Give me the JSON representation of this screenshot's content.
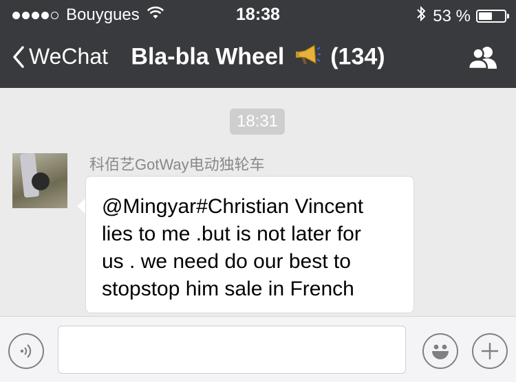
{
  "status_bar": {
    "carrier": "Bouygues",
    "time": "18:38",
    "battery_percent": "53 %",
    "battery_level": 0.53,
    "signal_filled_dots": 4,
    "signal_total_dots": 5
  },
  "nav": {
    "back_label": "WeChat",
    "title_main": "Bla-bla Wheel",
    "title_count": "(134)"
  },
  "chat": {
    "timestamp": "18:31",
    "messages": [
      {
        "sender": "科佰艺GotWay电动独轮车",
        "text": "@Mingyar#Christian  Vincent\nlies to me .but is not later for\nus . we need  do our best to\nstopstop him sale in  French"
      }
    ]
  },
  "input": {
    "value": "",
    "placeholder": ""
  },
  "colors": {
    "header_bg": "#393a3e",
    "chat_bg": "#ebebeb",
    "bubble_bg": "#ffffff",
    "input_bar_bg": "#f4f4f6"
  },
  "icons": {
    "back": "chevron-left-icon",
    "megaphone": "megaphone-icon",
    "contacts": "group-contacts-icon",
    "voice": "voice-icon",
    "emoji": "emoji-icon",
    "plus": "plus-icon",
    "wifi": "wifi-icon",
    "bluetooth": "bluetooth-icon",
    "battery": "battery-icon"
  }
}
